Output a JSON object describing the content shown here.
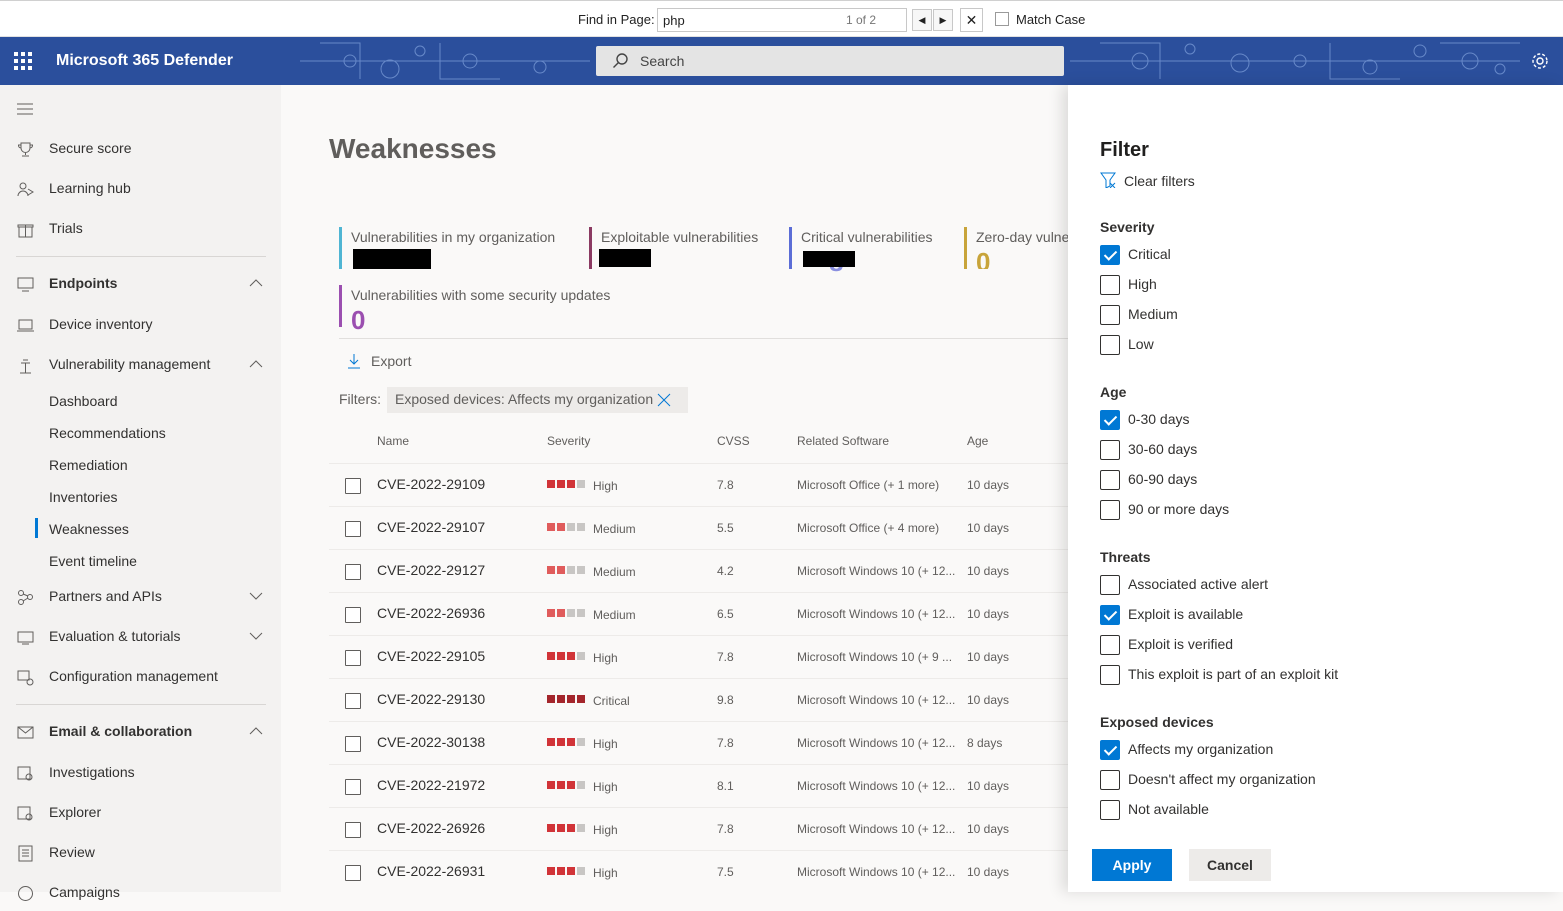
{
  "find_bar": {
    "label": "Find in Page:",
    "query": "php",
    "match_count": "1 of 2",
    "match_case_label": "Match Case",
    "close_glyph": "✕",
    "prev_glyph": "◀",
    "next_glyph": "▶"
  },
  "header": {
    "app_title": "Microsoft 365 Defender",
    "search_placeholder": "Search",
    "brand_color": "#2b4f9c"
  },
  "sidebar": {
    "items": [
      {
        "label": "Secure score",
        "icon": "trophy-icon"
      },
      {
        "label": "Learning hub",
        "icon": "people-learning-icon"
      },
      {
        "label": "Trials",
        "icon": "gift-icon"
      },
      {
        "label": "Endpoints",
        "icon": "endpoints-icon",
        "expanded": true
      },
      {
        "label": "Device inventory",
        "icon": "laptop-icon"
      },
      {
        "label": "Vulnerability management",
        "icon": "vulnerability-icon",
        "expanded": true
      },
      {
        "label": "Partners and APIs",
        "icon": "partners-icon",
        "expanded": false
      },
      {
        "label": "Evaluation & tutorials",
        "icon": "evaluation-icon",
        "expanded": false
      },
      {
        "label": "Configuration management",
        "icon": "config-icon"
      },
      {
        "label": "Email & collaboration",
        "icon": "mail-icon",
        "expanded": true
      },
      {
        "label": "Investigations",
        "icon": "investigations-icon"
      },
      {
        "label": "Explorer",
        "icon": "explorer-icon"
      },
      {
        "label": "Review",
        "icon": "review-icon"
      },
      {
        "label": "Campaigns",
        "icon": "campaigns-icon"
      }
    ],
    "sub_items": [
      "Dashboard",
      "Recommendations",
      "Remediation",
      "Inventories",
      "Weaknesses",
      "Event timeline"
    ],
    "selected": "Weaknesses"
  },
  "main": {
    "title": "Weaknesses",
    "metrics": [
      {
        "label": "Vulnerabilities in my organization",
        "value": "",
        "color": "#4fb5d3",
        "redacted": true
      },
      {
        "label": "Exploitable vulnerabilities",
        "value": "",
        "color": "#8b3a62",
        "redacted": true
      },
      {
        "label": "Critical vulnerabilities",
        "value": "8",
        "color": "#5b6dd6",
        "redacted": true
      },
      {
        "label": "Zero-day vulne",
        "value": "0",
        "color": "#c8a43a",
        "redacted": false
      },
      {
        "label": "Vulnerabilities with some security updates",
        "value": "0",
        "color": "#9b4fb0",
        "redacted": false
      }
    ],
    "export_label": "Export",
    "filters_label": "Filters:",
    "filter_chip": "Exposed devices: Affects my organization",
    "columns": [
      "Name",
      "Severity",
      "CVSS",
      "Related Software",
      "Age"
    ],
    "rows": [
      {
        "name": "CVE-2022-29109",
        "severity": "High",
        "level": 3,
        "cvss": "7.8",
        "software": "Microsoft Office (+ 1 more)",
        "age": "10 days"
      },
      {
        "name": "CVE-2022-29107",
        "severity": "Medium",
        "level": 2,
        "cvss": "5.5",
        "software": "Microsoft Office (+ 4 more)",
        "age": "10 days"
      },
      {
        "name": "CVE-2022-29127",
        "severity": "Medium",
        "level": 2,
        "cvss": "4.2",
        "software": "Microsoft Windows 10 (+ 12...",
        "age": "10 days"
      },
      {
        "name": "CVE-2022-26936",
        "severity": "Medium",
        "level": 2,
        "cvss": "6.5",
        "software": "Microsoft Windows 10 (+ 12...",
        "age": "10 days"
      },
      {
        "name": "CVE-2022-29105",
        "severity": "High",
        "level": 3,
        "cvss": "7.8",
        "software": "Microsoft Windows 10 (+ 9 ...",
        "age": "10 days"
      },
      {
        "name": "CVE-2022-29130",
        "severity": "Critical",
        "level": 4,
        "cvss": "9.8",
        "software": "Microsoft Windows 10 (+ 12...",
        "age": "10 days"
      },
      {
        "name": "CVE-2022-30138",
        "severity": "High",
        "level": 3,
        "cvss": "7.8",
        "software": "Microsoft Windows 10 (+ 12...",
        "age": "8 days"
      },
      {
        "name": "CVE-2022-21972",
        "severity": "High",
        "level": 3,
        "cvss": "8.1",
        "software": "Microsoft Windows 10 (+ 12...",
        "age": "10 days"
      },
      {
        "name": "CVE-2022-26926",
        "severity": "High",
        "level": 3,
        "cvss": "7.8",
        "software": "Microsoft Windows 10 (+ 12...",
        "age": "10 days"
      },
      {
        "name": "CVE-2022-26931",
        "severity": "High",
        "level": 3,
        "cvss": "7.5",
        "software": "Microsoft Windows 10 (+ 12...",
        "age": "10 days"
      }
    ],
    "severity_colors": {
      "Critical": "#a4262c",
      "High": "#d13438",
      "Medium": "#e05c5c",
      "Low": "#c8c6c4"
    }
  },
  "filter_panel": {
    "title": "Filter",
    "clear_label": "Clear filters",
    "groups": [
      {
        "title": "Severity",
        "options": [
          {
            "label": "Critical",
            "checked": true
          },
          {
            "label": "High",
            "checked": false
          },
          {
            "label": "Medium",
            "checked": false
          },
          {
            "label": "Low",
            "checked": false
          }
        ]
      },
      {
        "title": "Age",
        "options": [
          {
            "label": "0-30 days",
            "checked": true
          },
          {
            "label": "30-60 days",
            "checked": false
          },
          {
            "label": "60-90 days",
            "checked": false
          },
          {
            "label": "90 or more days",
            "checked": false
          }
        ]
      },
      {
        "title": "Threats",
        "options": [
          {
            "label": "Associated active alert",
            "checked": false
          },
          {
            "label": "Exploit is available",
            "checked": true
          },
          {
            "label": "Exploit is verified",
            "checked": false
          },
          {
            "label": "This exploit is part of an exploit kit",
            "checked": false
          }
        ]
      },
      {
        "title": "Exposed devices",
        "options": [
          {
            "label": "Affects my organization",
            "checked": true
          },
          {
            "label": "Doesn't affect my organization",
            "checked": false
          },
          {
            "label": "Not available",
            "checked": false
          }
        ]
      }
    ],
    "apply_label": "Apply",
    "cancel_label": "Cancel"
  }
}
